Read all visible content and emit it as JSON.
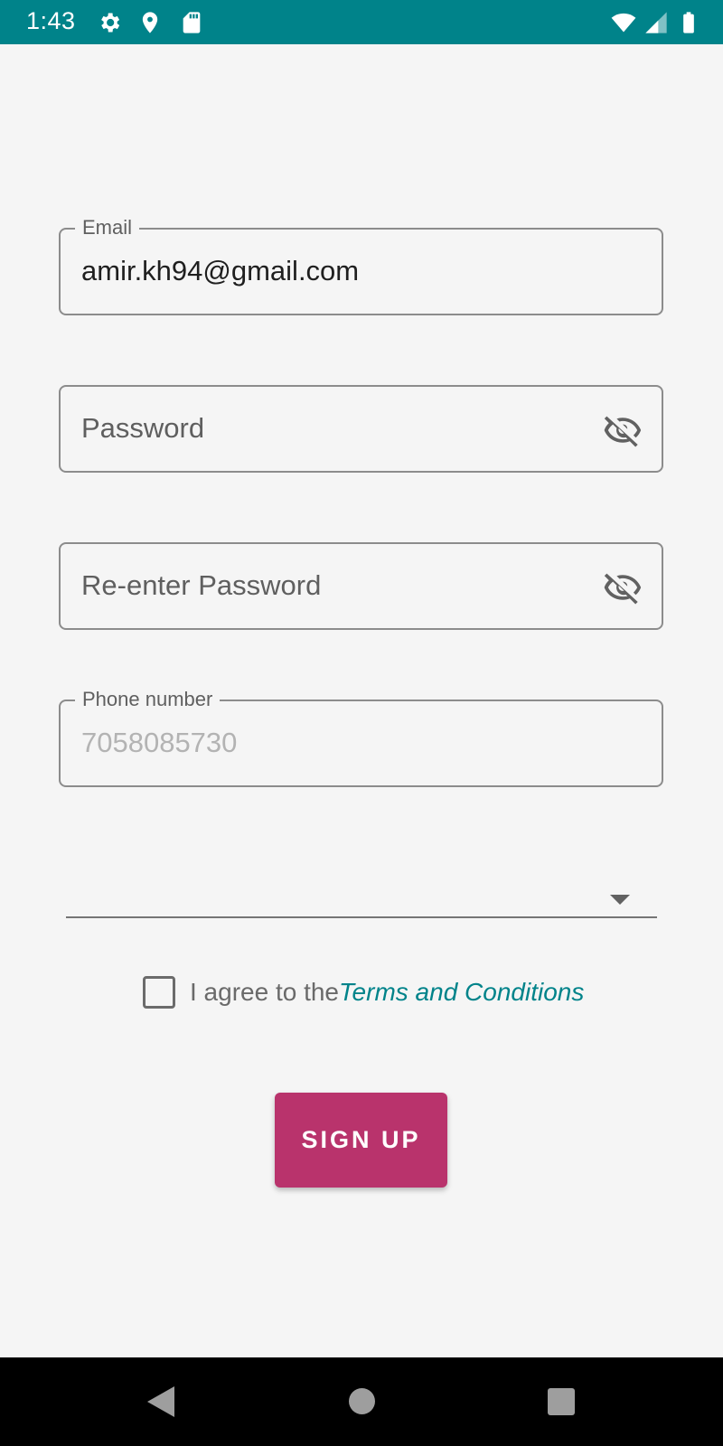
{
  "status_bar": {
    "time": "1:43",
    "background_color": "#00838a",
    "left_icons": [
      "gear-icon",
      "location-pin-icon",
      "sd-card-icon"
    ],
    "right_icons": [
      "wifi-icon",
      "cell-signal-icon",
      "battery-icon"
    ]
  },
  "form": {
    "email": {
      "label": "Email",
      "value": "amir.kh94@gmail.com"
    },
    "password": {
      "placeholder": "Password",
      "toggle_icon": "eye-off-icon"
    },
    "reenter_password": {
      "placeholder": "Re-enter Password",
      "toggle_icon": "eye-off-icon"
    },
    "phone": {
      "label": "Phone number",
      "hint": "7058085730"
    },
    "dropdown": {
      "selected": "",
      "arrow_icon": "dropdown-arrow-icon"
    },
    "agree": {
      "checked": false,
      "prefix": "I agree to the",
      "link_text": "Terms and Conditions",
      "link_color": "#00838a"
    },
    "signup_button": {
      "label": "SIGN UP",
      "color": "#b9336c"
    }
  },
  "nav_bar": {
    "icons": [
      "back-icon",
      "home-icon",
      "recents-icon"
    ]
  }
}
